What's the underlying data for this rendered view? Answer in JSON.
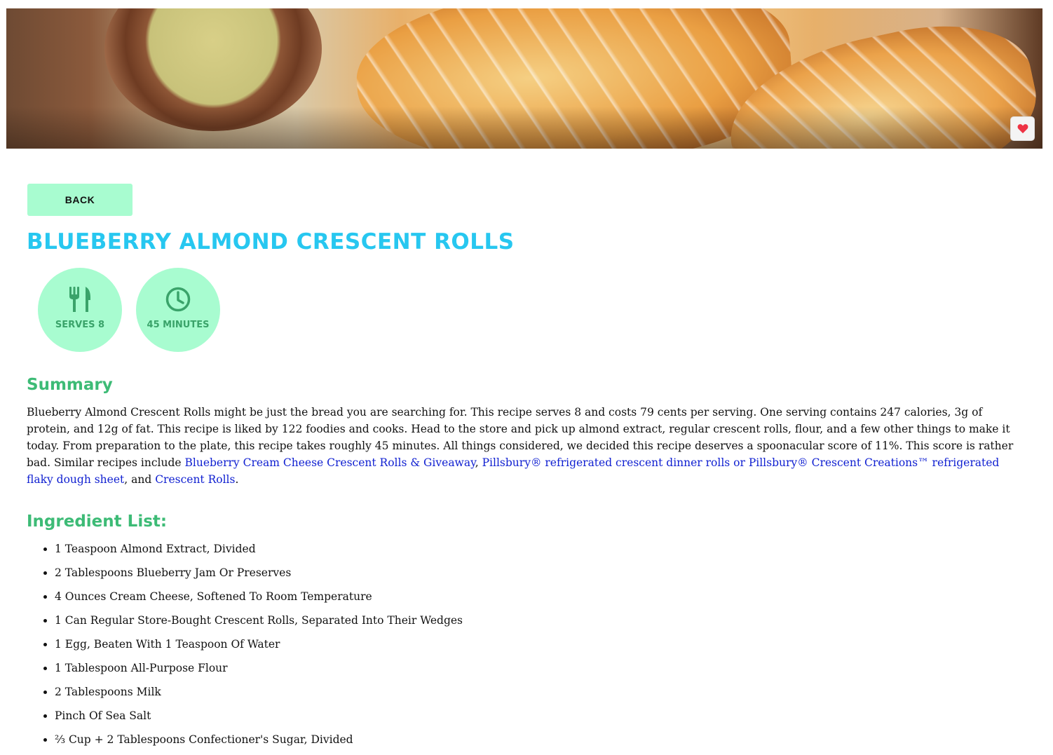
{
  "hero": {
    "image_alt": "Blueberry Almond Crescent Rolls photo",
    "favorite_icon": "heart-icon",
    "favorite_color": "#ee3344"
  },
  "back_button": {
    "label": "BACK"
  },
  "recipe": {
    "title": "BLUEBERRY ALMOND CRESCENT ROLLS",
    "serves_label": "SERVES 8",
    "time_label": "45 MINUTES",
    "serves_icon": "utensils-icon",
    "time_icon": "clock-icon"
  },
  "summary": {
    "heading": "Summary",
    "text_intro": "Blueberry Almond Crescent Rolls might be just the bread you are searching for. This recipe serves 8 and costs 79 cents per serving. One serving contains 247 calories, 3g of protein, and 12g of fat. This recipe is liked by 122 foodies and cooks. Head to the store and pick up almond extract, regular crescent rolls, flour, and a few other things to make it today. From preparation to the plate, this recipe takes roughly 45 minutes. All things considered, we decided this recipe deserves a spoonacular score of 11%. This score is rather bad. Similar recipes include ",
    "link1": "Blueberry Cream Cheese Crescent Rolls & Giveaway",
    "sep1": ", ",
    "link2": "Pillsbury® refrigerated crescent dinner rolls or Pillsbury® Crescent Creations™ refrigerated flaky dough sheet",
    "sep2": ", and ",
    "link3": "Crescent Rolls",
    "end": "."
  },
  "ingredients": {
    "heading": "Ingredient List:",
    "items": [
      "1 Teaspoon Almond Extract, Divided",
      "2 Tablespoons Blueberry Jam Or Preserves",
      "4 Ounces Cream Cheese, Softened To Room Temperature",
      "1 Can Regular Store-Bought Crescent Rolls, Separated Into Their Wedges",
      "1 Egg, Beaten With 1 Teaspoon Of Water",
      "1 Tablespoon All-Purpose Flour",
      "2 Tablespoons Milk",
      "Pinch Of Sea Salt",
      "⅔ Cup + 2 Tablespoons Confectioner's Sugar, Divided"
    ]
  },
  "colors": {
    "accent_title": "#27c7f0",
    "accent_green": "#3dbb76",
    "badge_bg": "#a8fcd0",
    "link": "#0f1fd1"
  }
}
